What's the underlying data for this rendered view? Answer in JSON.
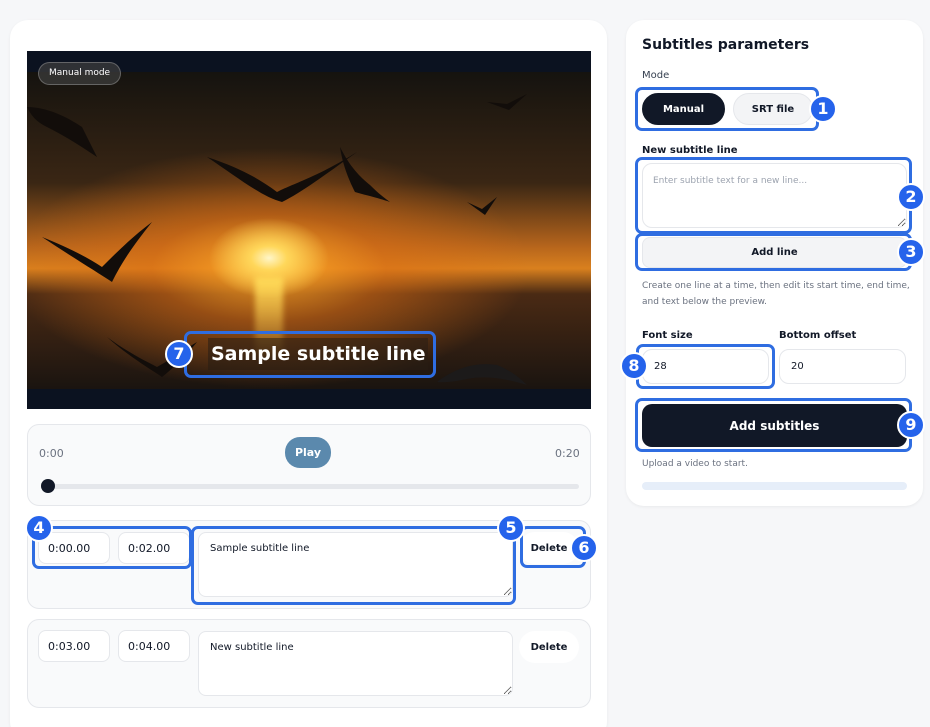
{
  "video": {
    "mode_chip": "Manual mode",
    "subtitle_overlay": "Sample subtitle line"
  },
  "player": {
    "current_time": "0:00",
    "duration": "0:20",
    "play_label": "Play",
    "progress": 0
  },
  "subtitle_rows": [
    {
      "start": "0:00.00",
      "end": "0:02.00",
      "text": "Sample subtitle line",
      "delete_label": "Delete"
    },
    {
      "start": "0:03.00",
      "end": "0:04.00",
      "text": "New subtitle line",
      "delete_label": "Delete"
    }
  ],
  "panel": {
    "title": "Subtitles parameters",
    "mode_label": "Mode",
    "mode_options": [
      "Manual",
      "SRT file"
    ],
    "mode_selected": "Manual",
    "new_line_label": "New subtitle line",
    "new_line_placeholder": "Enter subtitle text for a new line...",
    "add_line_label": "Add line",
    "hint": "Create one line at a time, then edit its start time, end time, and text below the preview.",
    "font_size_label": "Font size",
    "font_size_value": "28",
    "bottom_offset_label": "Bottom offset",
    "bottom_offset_value": "20",
    "submit_label": "Add subtitles",
    "status": "Upload a video to start.",
    "upload_progress": 0
  },
  "callouts": [
    "1",
    "2",
    "3",
    "4",
    "5",
    "6",
    "7",
    "8",
    "9"
  ],
  "colors": {
    "accent": "#2563eb",
    "primary_button": "#111827",
    "play_button": "#5b89ad"
  }
}
